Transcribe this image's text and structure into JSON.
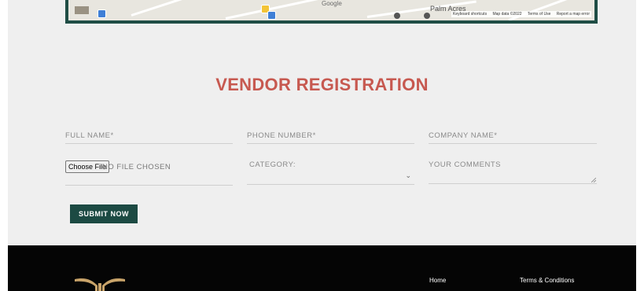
{
  "map": {
    "place_label": "Palm Acres",
    "google_label": "Google",
    "attribution": [
      "Keyboard shortcuts",
      "Map data ©2022",
      "Terms of Use",
      "Report a map error"
    ]
  },
  "form": {
    "title": "VENDOR REGISTRATION",
    "full_name_placeholder": "FULL NAME*",
    "phone_placeholder": "PHONE NUMBER*",
    "company_placeholder": "COMPANY NAME*",
    "file_button": "Choose File",
    "file_status": "NO FILE CHOSEN",
    "category_placeholder": "CATEGORY:",
    "comments_placeholder": "YOUR COMMENTS",
    "submit_label": "SUBMIT NOW"
  },
  "footer": {
    "links": [
      "Home",
      "Terms & Conditions"
    ]
  },
  "colors": {
    "accent_title": "#c75950",
    "button_bg": "#1c4a43",
    "footer_bg": "#050505",
    "logo_gold": "#c9a46a"
  }
}
